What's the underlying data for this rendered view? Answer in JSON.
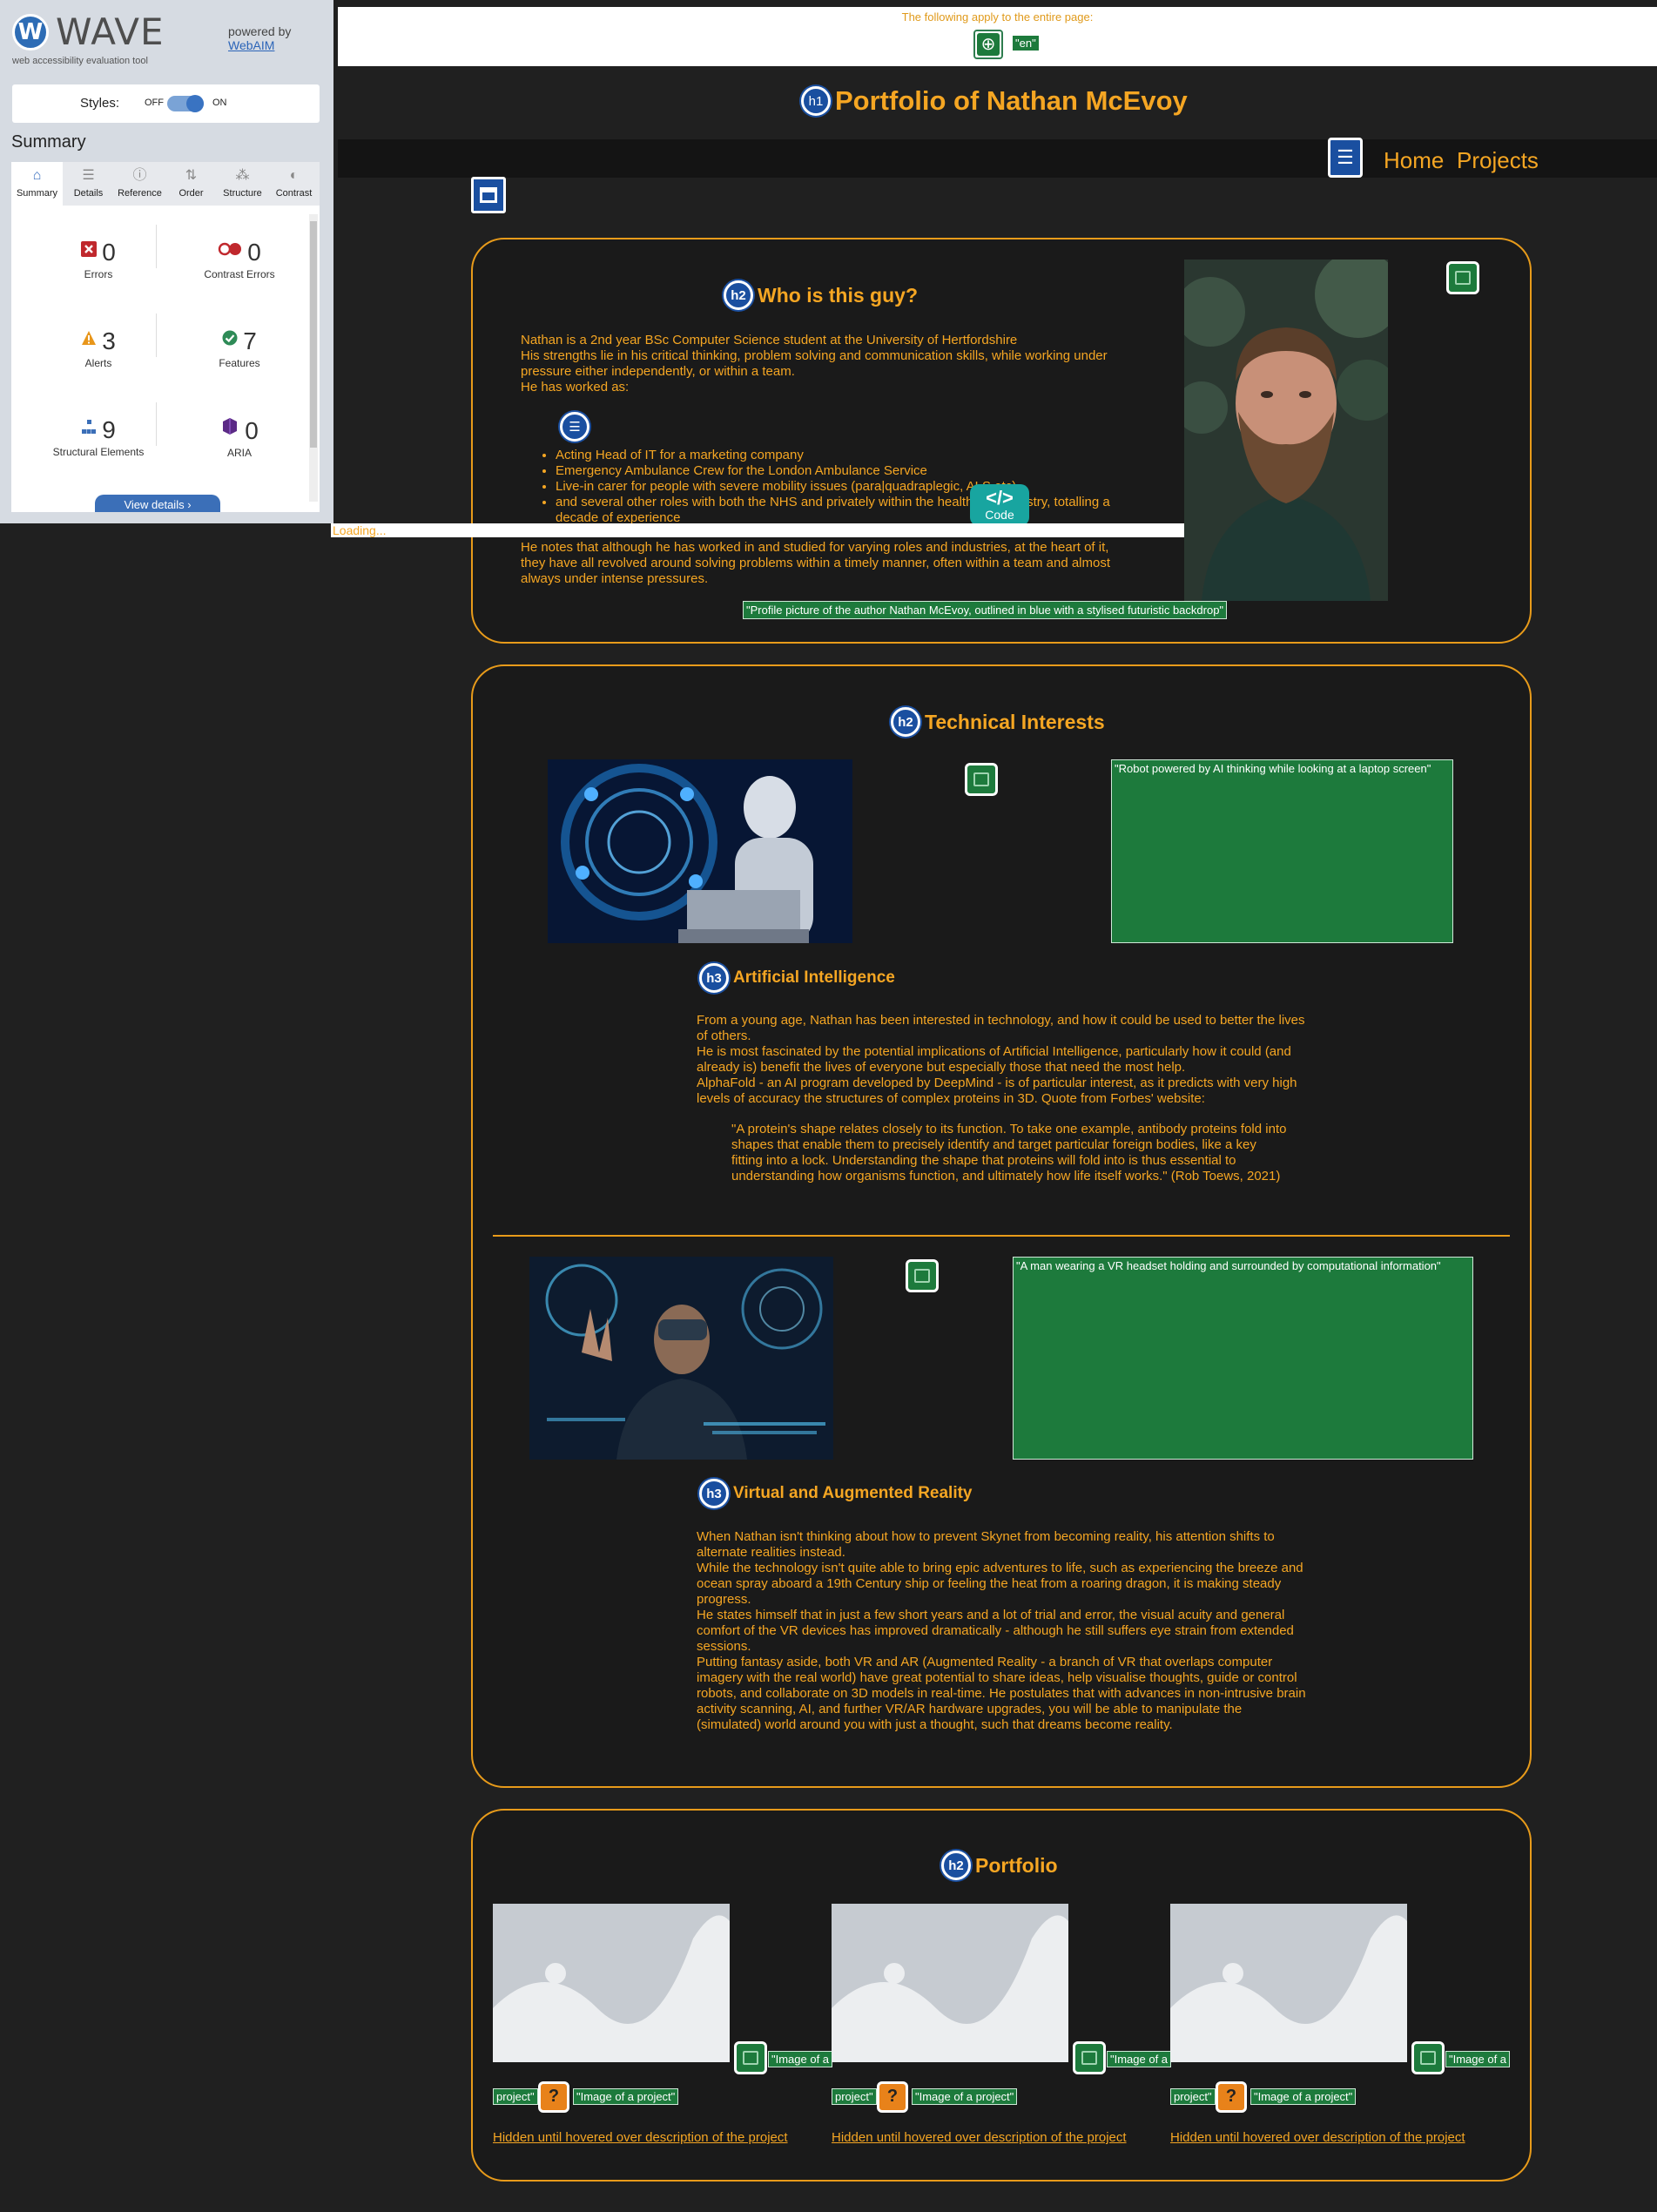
{
  "wave": {
    "logo_letter": "W",
    "name": "WAVE",
    "tagline": "web accessibility evaluation tool",
    "powered_by": "powered by",
    "webaim_link": "WebAIM",
    "styles_label": "Styles:",
    "styles_off": "OFF",
    "styles_on": "ON",
    "styles_state": "on",
    "summary_heading": "Summary",
    "active_tab": "Summary",
    "tabs": [
      {
        "label": "Summary",
        "icon": "home-icon"
      },
      {
        "label": "Details",
        "icon": "list-icon"
      },
      {
        "label": "Reference",
        "icon": "info-icon"
      },
      {
        "label": "Order",
        "icon": "order-icon"
      },
      {
        "label": "Structure",
        "icon": "structure-icon"
      },
      {
        "label": "Contrast",
        "icon": "contrast-icon"
      }
    ],
    "stats": {
      "errors": {
        "count": "0",
        "label": "Errors",
        "color": "#c0282d"
      },
      "contrast_errors": {
        "count": "0",
        "label": "Contrast Errors",
        "color": "#c0282d"
      },
      "alerts": {
        "count": "3",
        "label": "Alerts",
        "color": "#e8961a"
      },
      "features": {
        "count": "7",
        "label": "Features",
        "color": "#2e8b57"
      },
      "structural": {
        "count": "9",
        "label": "Structural Elements",
        "color": "#3b6fb8"
      },
      "aria": {
        "count": "0",
        "label": "ARIA",
        "color": "#5b2a86"
      }
    },
    "view_details": "View details ›"
  },
  "page_info": {
    "applies_text": "The following apply to the entire page:",
    "language_badge": "\"en\""
  },
  "site": {
    "h1_badge": "h1",
    "title": "Portfolio of Nathan McEvoy",
    "nav": {
      "home": "Home",
      "projects": "Projects"
    }
  },
  "about": {
    "badge": "h2",
    "heading": "Who is this guy?",
    "intro": "Nathan is a 2nd year BSc Computer Science student at the University of Hertfordshire\nHis strengths lie in his critical thinking, problem solving and communication skills, while working under pressure either independently, or within a team.\nHe has worked as:",
    "roles": [
      "Acting Head of IT for a marketing company",
      "Emergency Ambulance Crew for the London Ambulance Service",
      "Live-in carer for people with severe mobility issues (para|quadraplegic, ALS etc)",
      "and several other roles with both the NHS and privately within the healthcare industry, totalling a decade of experience"
    ],
    "closing": "He notes that although he has worked in and studied for varying roles and industries, at the heart of it, they have all revolved around solving problems within a timely manner, often within a team and almost always under intense pressures.",
    "photo_alt": "\"Profile picture of the author Nathan McEvoy, outlined in blue with a stylised futuristic backdrop\"",
    "code_label": "Code",
    "code_symbol": "</>",
    "loading_text": "Loading..."
  },
  "interests": {
    "badge": "h2",
    "heading": "Technical Interests",
    "ai": {
      "badge": "h3",
      "heading": "Artificial Intelligence",
      "image_alt": "\"Robot powered by AI thinking while looking at a laptop screen\"",
      "text": "From a young age, Nathan has been interested in technology, and how it could be used to better the lives of others.\nHe is most fascinated by the potential implications of Artificial Intelligence, particularly how it could (and already is) benefit the lives of everyone but especially those that need the most help.\nAlphaFold - an AI program developed by DeepMind - is of particular interest, as it predicts with very high levels of accuracy the structures of complex proteins in 3D. Quote from Forbes' website:",
      "quote": "\"A protein's shape relates closely to its function. To take one example, antibody proteins fold into shapes that enable them to precisely identify and target particular foreign bodies, like a key fitting into a lock. Understanding the shape that proteins will fold into is thus essential to understanding how organisms function, and ultimately how life itself works.\" (Rob Toews, 2021)"
    },
    "vr": {
      "badge": "h3",
      "heading": "Virtual and Augmented Reality",
      "image_alt": "\"A man wearing a VR headset holding and surrounded by computational information\"",
      "text": "When Nathan isn't thinking about how to prevent Skynet from becoming reality, his attention shifts to alternate realities instead.\nWhile the technology isn't quite able to bring epic adventures to life, such as experiencing the breeze and ocean spray aboard a 19th Century ship or feeling the heat from a roaring dragon, it is making steady progress.\nHe states himself that in just a few short years and a lot of trial and error, the visual acuity and general comfort of the VR devices has improved dramatically - although he still suffers eye strain from extended sessions.\nPutting fantasy aside, both VR and AR (Augmented Reality - a branch of VR that overlaps computer imagery with the real world) have great potential to share ideas, help visualise thoughts, guide or control robots, and collaborate on 3D models in real-time. He postulates that with advances in non-intrusive brain activity scanning, AI, and further VR/AR hardware upgrades, you will be able to manipulate the (simulated) world around you with just a thought, such that dreams become reality."
    }
  },
  "portfolio": {
    "badge": "h2",
    "heading": "Portfolio",
    "items": [
      {
        "alt_a": "\"Image of a",
        "alt_b": "project\"",
        "alt_c": "\"Image of a project\"",
        "alert": "?",
        "description": "Hidden until hovered over description of the project"
      },
      {
        "alt_a": "\"Image of a",
        "alt_b": "project\"",
        "alt_c": "\"Image of a project\"",
        "alert": "?",
        "description": "Hidden until hovered over description of the project"
      },
      {
        "alt_a": "\"Image of a",
        "alt_b": "project\"",
        "alt_c": "\"Image of a project\"",
        "alert": "?",
        "description": "Hidden until hovered over description of the project"
      }
    ]
  },
  "colors": {
    "accent": "#f5a623",
    "background": "#202020",
    "card_border": "#e89b1a",
    "wave_feature_green": "#1d7a3c",
    "wave_structure_blue": "#1a4fa0",
    "wave_alert_orange": "#e8821a"
  }
}
